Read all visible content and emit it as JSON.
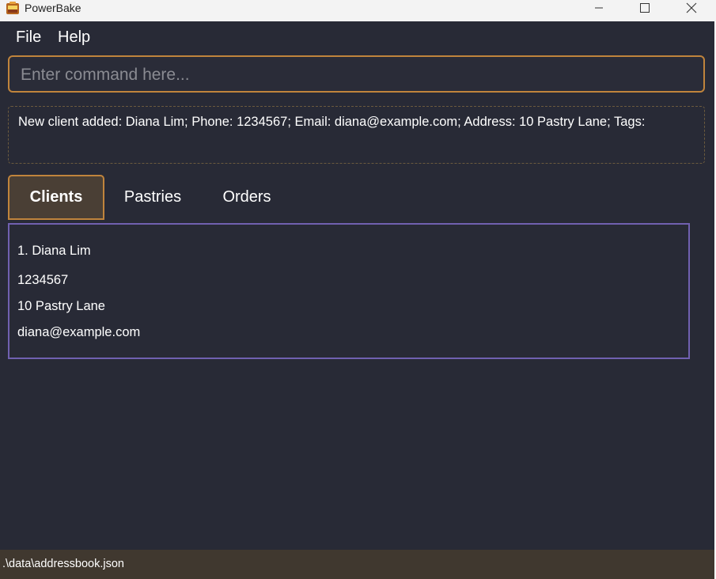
{
  "titlebar": {
    "title": "PowerBake",
    "icons": [
      "app-icon",
      "minimize-icon",
      "maximize-icon",
      "close-icon"
    ]
  },
  "menu": {
    "file": "File",
    "help": "Help"
  },
  "command": {
    "placeholder": "Enter command here...",
    "value": ""
  },
  "result": {
    "text": "New client added: Diana Lim; Phone: 1234567; Email: diana@example.com; Address: 10 Pastry Lane; Tags:"
  },
  "tabs": [
    {
      "label": "Clients",
      "active": true
    },
    {
      "label": "Pastries",
      "active": false
    },
    {
      "label": "Orders",
      "active": false
    }
  ],
  "clients": [
    {
      "name": "1. Diana Lim",
      "phone": "1234567",
      "address": "10 Pastry Lane",
      "email": "diana@example.com"
    }
  ],
  "status": {
    "path": ".\\data\\addressbook.json"
  },
  "colors": {
    "background": "#282a36",
    "accent": "#c0843c",
    "active_tab": "#4a3f35",
    "list_border": "#7060b0",
    "status_bar": "#40382f"
  }
}
